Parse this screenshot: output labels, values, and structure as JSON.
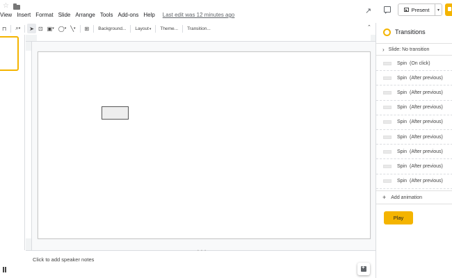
{
  "menu": {
    "items": [
      "View",
      "Insert",
      "Format",
      "Slide",
      "Arrange",
      "Tools",
      "Add-ons",
      "Help"
    ],
    "last_edit": "Last edit was 12 minutes ago"
  },
  "header": {
    "present_label": "Present"
  },
  "toolbar": {
    "background_label": "Background...",
    "layout_label": "Layout",
    "theme_label": "Theme...",
    "transition_label": "Transition..."
  },
  "notes": {
    "placeholder": "Click to add speaker notes"
  },
  "panel": {
    "title": "Transitions",
    "slide_transition": "Slide: No transition",
    "animations": [
      {
        "type": "Spin",
        "trigger": "(On click)"
      },
      {
        "type": "Spin",
        "trigger": "(After previous)"
      },
      {
        "type": "Spin",
        "trigger": "(After previous)"
      },
      {
        "type": "Spin",
        "trigger": "(After previous)"
      },
      {
        "type": "Spin",
        "trigger": "(After previous)"
      },
      {
        "type": "Spin",
        "trigger": "(After previous)"
      },
      {
        "type": "Spin",
        "trigger": "(After previous)"
      },
      {
        "type": "Spin",
        "trigger": "(After previous)"
      },
      {
        "type": "Spin",
        "trigger": "(After previous)"
      }
    ],
    "add_animation_label": "Add animation",
    "play_label": "Play"
  },
  "colors": {
    "accent": "#f4b400",
    "border": "#dadce0",
    "text": "#202124"
  },
  "icons": [
    "star-icon",
    "folder-icon",
    "trending-icon",
    "comment-icon",
    "zoom-icon",
    "select-icon",
    "textbox-icon",
    "image-icon",
    "shape-icon",
    "line-icon",
    "comment-add-icon",
    "transitions-icon",
    "chevron-right-icon",
    "plus-icon",
    "explore-icon"
  ]
}
